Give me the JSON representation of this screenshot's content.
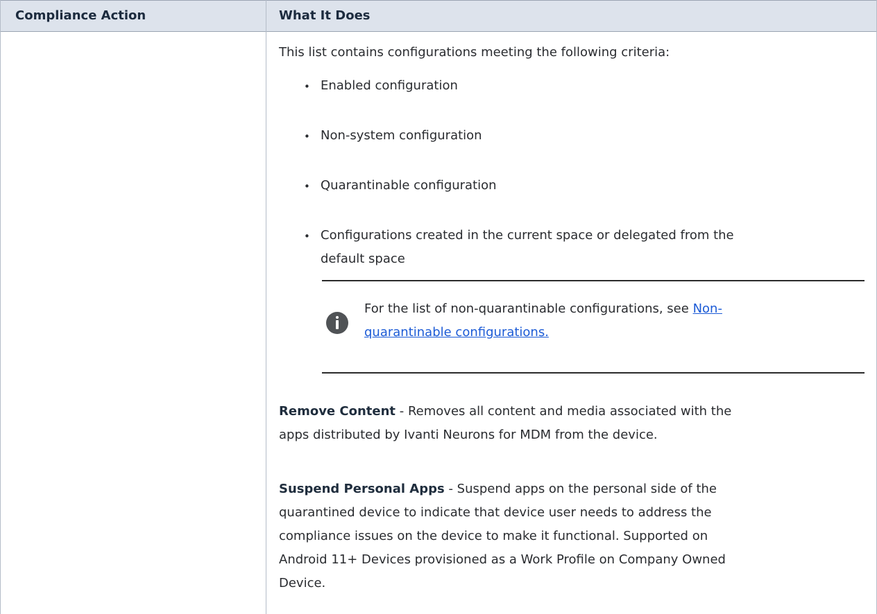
{
  "table": {
    "headers": {
      "col1": "Compliance Action",
      "col2": "What It Does"
    },
    "intro": "This list contains configurations meeting the following criteria:",
    "bullets": [
      "Enabled configuration",
      "Non-system configuration",
      "Quarantinable configuration",
      "Configurations created in the current space or delegated from the",
      "default space"
    ],
    "note": {
      "text_line1": "For the list of non-quarantinable configurations, see ",
      "link_part1": "Non-",
      "link_part2": "quarantinable configurations."
    },
    "remove_content": {
      "title": "Remove Content",
      "line1": " - Removes all content and media associated with the",
      "line2": "apps distributed by Ivanti Neurons for MDM from the device."
    },
    "suspend_apps": {
      "title": "Suspend Personal Apps",
      "line1": " - Suspend apps on the personal side of the",
      "line2": "quarantined device to indicate that device user needs to address the",
      "line3": "compliance issues on the device to make it functional. Supported on",
      "line4": "Android 11+ Devices provisioned as a Work Profile on Company Owned",
      "line5": "Device."
    }
  }
}
